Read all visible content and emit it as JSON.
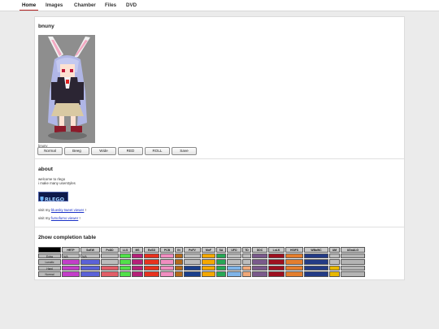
{
  "nav": {
    "tabs": [
      {
        "label": "Home",
        "active": true
      },
      {
        "label": "Images",
        "active": false
      },
      {
        "label": "Chamber",
        "active": false
      },
      {
        "label": "Files",
        "active": false
      },
      {
        "label": "DVD",
        "active": false
      }
    ]
  },
  "profile": {
    "title": "bnuny",
    "image_caption": "bnuny",
    "buttons": [
      "Normal",
      "Beeg",
      "Wide",
      "RED",
      "ROLL",
      "Save"
    ]
  },
  "about": {
    "title": "about",
    "line1": "welcome to rlego",
    "line2": "i make many userstyles",
    "logo_icon": "rlego-logo",
    "bluesky_prefix": "visit my ",
    "bluesky_link": "bluesky tweet viewer",
    "bluesky_suffix": " !",
    "fumofumo_prefix": "visit my ",
    "fumofumo_link": "fumofumo viewer",
    "fumofumo_suffix": " !"
  },
  "completion": {
    "title": "2how completion table",
    "columns": [
      "",
      "HRTP",
      "SoEW",
      "PoDD",
      "LLS",
      "MS",
      "EoSD",
      "PCB",
      "IN",
      "PoFV",
      "MoF",
      "SA",
      "UFO",
      "TD",
      "DDC",
      "LoLK",
      "HSiFS",
      "WBaWC",
      "UM",
      "UDoALG"
    ],
    "rows": [
      "Extra",
      "Lunatic",
      "Hard",
      "Normal"
    ],
    "notes": {
      "HRTP": "N/A",
      "SoEW": "N/A"
    },
    "colors": {
      "HRTP": "#c33fc9",
      "SoEW": "#5b62d8",
      "PoDD": "#e25e68",
      "LLS": "#52e04a",
      "MS": "#b62079",
      "EoSD": "#e8321e",
      "PCB": "#f08ec0",
      "IN": "#b56a1b",
      "PoFV": "#1a3f8c",
      "MoF": "#f5a800",
      "SA": "#27a856",
      "UFO": "#7fb4e8",
      "TD": "#f0a878",
      "DDC": "#7a5a8c",
      "LoLK": "#9e1020",
      "HSiFS": "#e47e2e",
      "WBaWC": "#233b86",
      "UM": "#e8b800",
      "UDoALG": "#b4b4b4",
      "uncleared": "#bdbdbd",
      "header": "#c9c9c9"
    },
    "cleared": {
      "Extra": [
        0,
        0,
        0,
        1,
        1,
        1,
        1,
        1,
        0,
        1,
        1,
        0,
        0,
        1,
        1,
        1,
        1,
        0,
        1
      ],
      "Lunatic": [
        1,
        1,
        0,
        1,
        1,
        1,
        1,
        1,
        0,
        1,
        1,
        0,
        0,
        1,
        1,
        1,
        1,
        0,
        1
      ],
      "Hard": [
        1,
        1,
        1,
        1,
        1,
        1,
        1,
        1,
        1,
        1,
        1,
        1,
        1,
        1,
        1,
        1,
        1,
        1,
        1
      ],
      "Normal": [
        1,
        1,
        1,
        1,
        1,
        1,
        1,
        1,
        1,
        1,
        1,
        1,
        1,
        1,
        1,
        1,
        1,
        1,
        1
      ]
    }
  }
}
